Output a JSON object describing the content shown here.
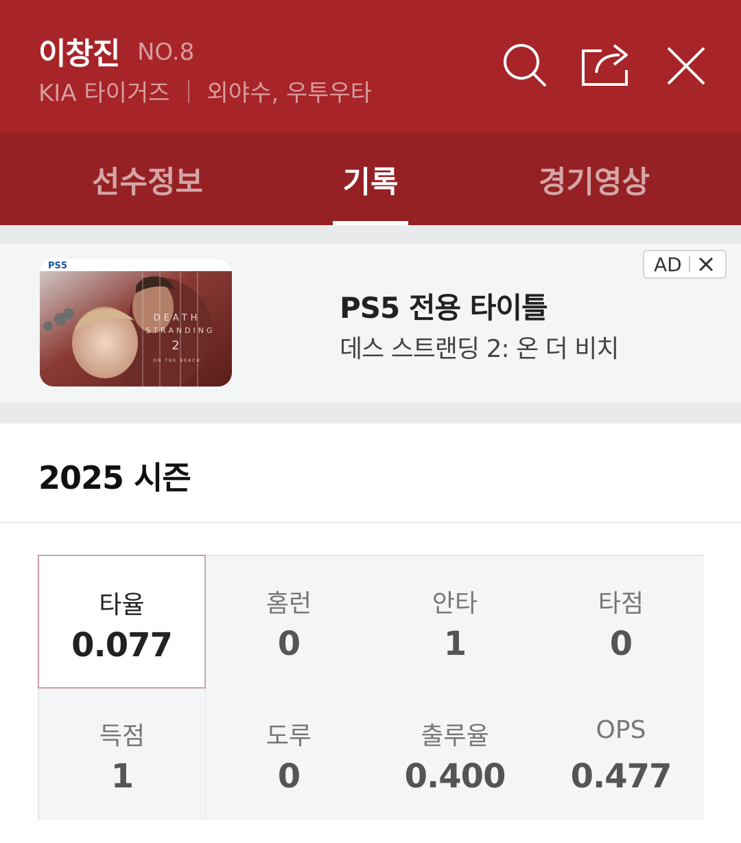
{
  "header": {
    "name": "이창진",
    "number": "NO.8",
    "team": "KIA 타이거즈",
    "positions": "외야수, 우투우타",
    "icons": [
      "search-icon",
      "share-icon",
      "close-icon"
    ],
    "background_color": "#a72428"
  },
  "tabs": [
    {
      "label": "선수정보",
      "active": false
    },
    {
      "label": "기록",
      "active": true
    },
    {
      "label": "경기영상",
      "active": false
    }
  ],
  "ad": {
    "title": "PS5 전용 타이틀",
    "description": "데스 스트랜딩 2: 온 더 비치",
    "badge_label": "AD",
    "image_text": {
      "platform": "PS5",
      "line1": "DEATH",
      "line2": "STRANDING",
      "number": "2",
      "subtitle": "ON THE BEACH"
    }
  },
  "season": {
    "title": "2025 시즌"
  },
  "stats": [
    {
      "label": "타율",
      "value": "0.077",
      "selected": true
    },
    {
      "label": "홈런",
      "value": "0"
    },
    {
      "label": "안타",
      "value": "1"
    },
    {
      "label": "타점",
      "value": "0"
    },
    {
      "label": "득점",
      "value": "1"
    },
    {
      "label": "도루",
      "value": "0"
    },
    {
      "label": "출루율",
      "value": "0.400"
    },
    {
      "label": "OPS",
      "value": "0.477"
    }
  ]
}
